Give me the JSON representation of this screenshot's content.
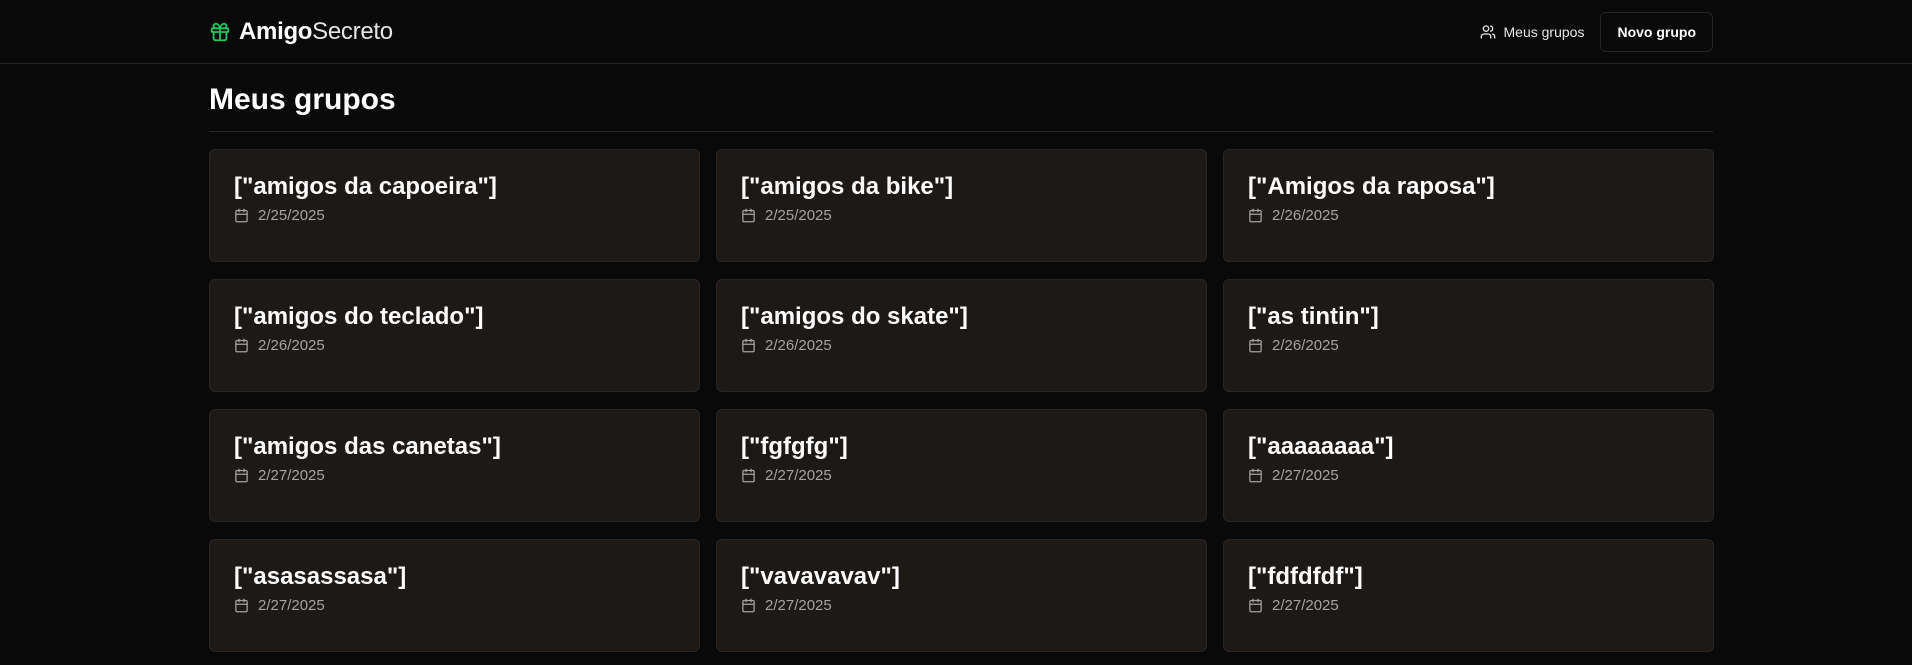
{
  "header": {
    "brand_bold": "Amigo",
    "brand_light": "Secreto",
    "nav_groups_label": "Meus grupos",
    "new_group_label": "Novo grupo"
  },
  "main": {
    "title": "Meus grupos",
    "groups": [
      {
        "name": "[\"amigos da capoeira\"]",
        "date": "2/25/2025"
      },
      {
        "name": "[\"amigos da bike\"]",
        "date": "2/25/2025"
      },
      {
        "name": "[\"Amigos da raposa\"]",
        "date": "2/26/2025"
      },
      {
        "name": "[\"amigos do teclado\"]",
        "date": "2/26/2025"
      },
      {
        "name": "[\"amigos do skate\"]",
        "date": "2/26/2025"
      },
      {
        "name": "[\"as tintin\"]",
        "date": "2/26/2025"
      },
      {
        "name": "[\"amigos das canetas\"]",
        "date": "2/27/2025"
      },
      {
        "name": "[\"fgfgfg\"]",
        "date": "2/27/2025"
      },
      {
        "name": "[\"aaaaaaaa\"]",
        "date": "2/27/2025"
      },
      {
        "name": "[\"asasassasa\"]",
        "date": "2/27/2025"
      },
      {
        "name": "[\"vavavavav\"]",
        "date": "2/27/2025"
      },
      {
        "name": "[\"fdfdfdf\"]",
        "date": "2/27/2025"
      }
    ]
  },
  "colors": {
    "background": "#0a0909",
    "card_background": "#1c1917",
    "card_border": "#292524",
    "brand_icon": "#22c55e",
    "muted_text": "#a8a29e"
  },
  "icons": {
    "brand": "gift-icon",
    "nav": "users-icon",
    "date": "calendar-icon"
  }
}
